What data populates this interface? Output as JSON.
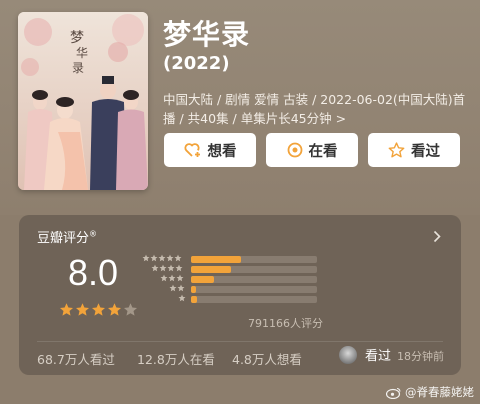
{
  "show": {
    "title": "梦华录",
    "year": "(2022)",
    "meta": "中国大陆 / 剧情 爱情 古装 / 2022-06-02(中国大陆)首播 / 共40集 / 单集片长45分钟 >"
  },
  "actions": {
    "want": "想看",
    "watching": "在看",
    "watched": "看过"
  },
  "rating": {
    "title": "豆瓣评分",
    "title_mark": "®",
    "score": "8.0",
    "stars": 4,
    "distribution": [
      {
        "stars": 5,
        "percent": 40
      },
      {
        "stars": 4,
        "percent": 32
      },
      {
        "stars": 3,
        "percent": 18
      },
      {
        "stars": 2,
        "percent": 4
      },
      {
        "stars": 1,
        "percent": 5
      }
    ],
    "votes": "791166人评分"
  },
  "stats": {
    "watched": "68.7万人看过",
    "watching": "12.8万人在看",
    "want": "4.8万人想看"
  },
  "friend": {
    "status": "看过",
    "time": "18分钟前"
  },
  "watermark": "@脊春藤姥姥",
  "colors": {
    "accent": "#f2a33a",
    "button_icon": "#f2a33a",
    "card_bg": "#6f6357"
  }
}
